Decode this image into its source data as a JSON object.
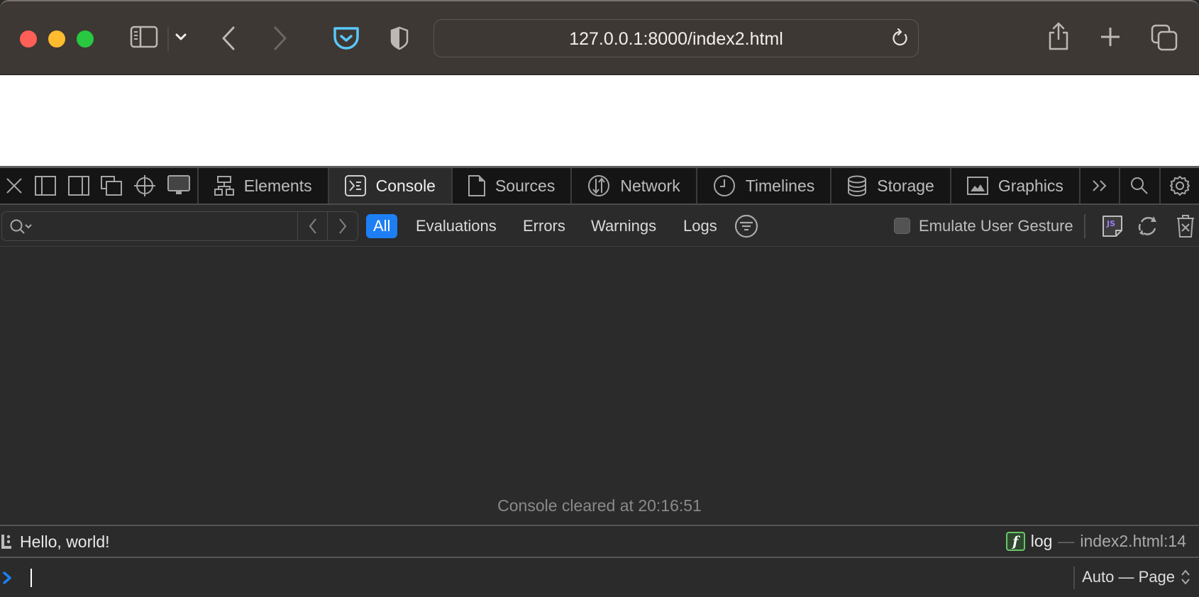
{
  "browser": {
    "url": "127.0.0.1:8000/index2.html",
    "icons": [
      "sidebar-icon",
      "chevron-down-icon",
      "back-icon",
      "forward-icon",
      "pocket-icon",
      "privacy-shield-icon",
      "reload-icon",
      "share-icon",
      "new-tab-icon",
      "tab-overview-icon"
    ]
  },
  "devtools": {
    "toolbar_icons": [
      "close-icon",
      "dock-left-icon",
      "dock-right-icon",
      "undock-icon",
      "inspect-element-icon",
      "device-icon"
    ],
    "tabs": [
      {
        "label": "Elements",
        "icon": "elements-icon"
      },
      {
        "label": "Console",
        "icon": "console-icon",
        "active": true
      },
      {
        "label": "Sources",
        "icon": "sources-icon"
      },
      {
        "label": "Network",
        "icon": "network-icon"
      },
      {
        "label": "Timelines",
        "icon": "timelines-icon"
      },
      {
        "label": "Storage",
        "icon": "storage-icon"
      },
      {
        "label": "Graphics",
        "icon": "graphics-icon"
      }
    ],
    "overflow_label": "»",
    "filter": {
      "search_value": "",
      "levels": [
        {
          "label": "All",
          "active": true
        },
        {
          "label": "Evaluations"
        },
        {
          "label": "Errors"
        },
        {
          "label": "Warnings"
        },
        {
          "label": "Logs"
        }
      ],
      "emulate_gesture_label": "Emulate User Gesture",
      "emulate_gesture_checked": false,
      "js_badge": "JS"
    },
    "console": {
      "cleared_message": "Console cleared at 20:16:51",
      "messages": [
        {
          "text": "Hello, world!",
          "function_badge": "f",
          "function": "log",
          "separator": "—",
          "location": "index2.html:14"
        }
      ],
      "prompt_value": "",
      "context_selector": "Auto — Page"
    }
  },
  "colors": {
    "accent": "#1d7ff3",
    "toolbar_bg": "#3d3834",
    "devtools_bg": "#2b2b2b",
    "tabbar_bg": "#151515",
    "pocket": "#5ac8fa"
  }
}
